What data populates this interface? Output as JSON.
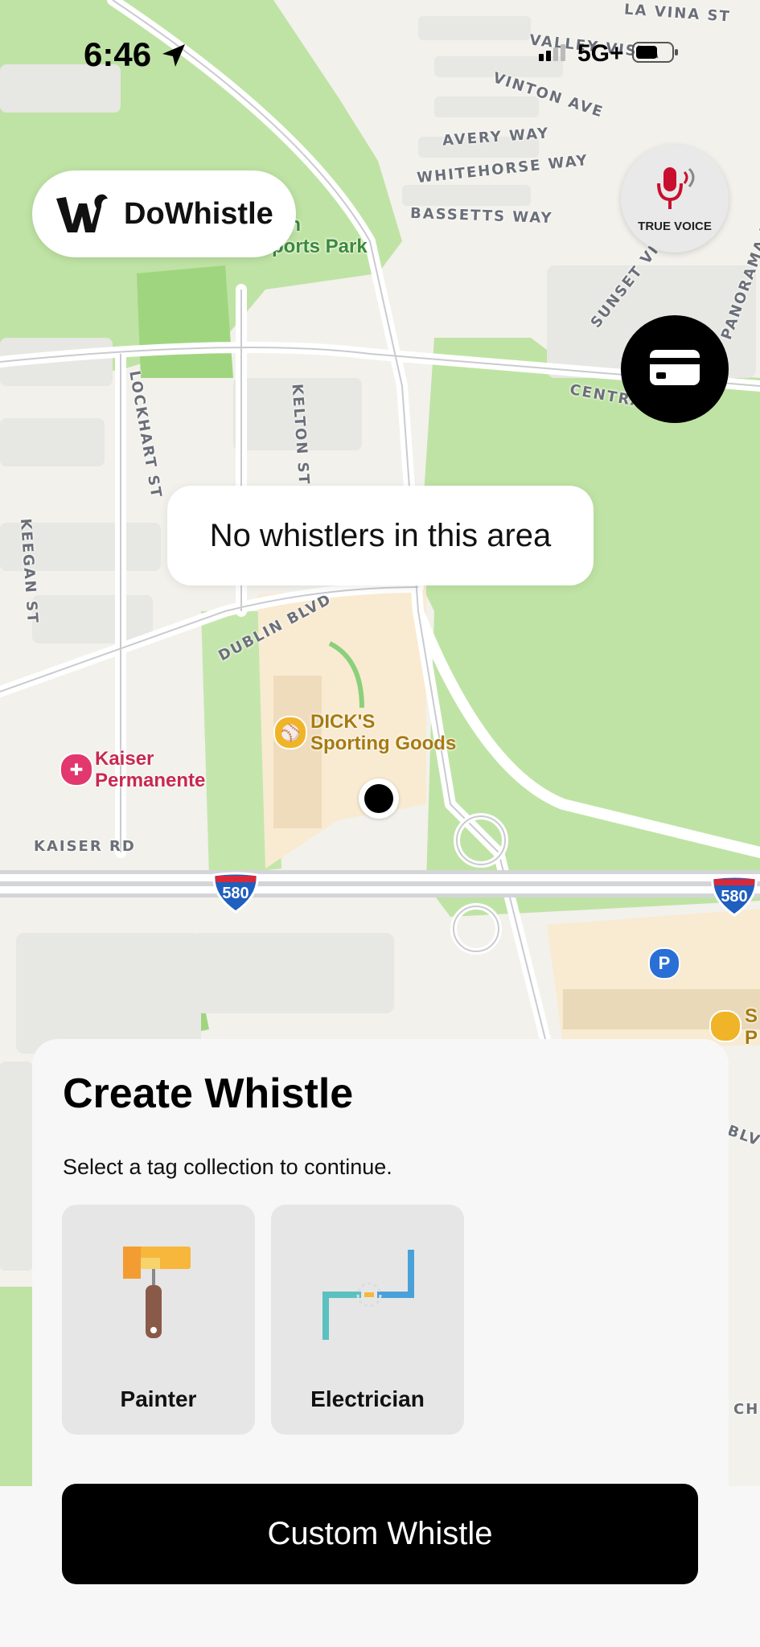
{
  "status_bar": {
    "time": "6:46",
    "network": "5G+"
  },
  "brand": {
    "name": "DoWhistle"
  },
  "true_voice": {
    "label": "TRUE VOICE"
  },
  "toast": {
    "message": "No whistlers in this area"
  },
  "map": {
    "streets": [
      "LA VINA ST",
      "VALLEY VISTA",
      "VINTON AVE",
      "AVERY WAY",
      "WHITEHORSE WAY",
      "BASSETTS WAY",
      "SUNSET VIE",
      "PANORAMA DR",
      "CENTRA",
      "LOCKHART ST",
      "KELTON ST",
      "KEEGAN ST",
      "DUBLIN BLVD",
      "KAISER RD",
      "BLV",
      "CH"
    ],
    "park": "lon\nports Park",
    "highway_shield": "580",
    "pois": {
      "dicks": "DICK'S\nSporting Goods",
      "kaiser": "Kaiser\nPermanente",
      "partial": "S\nP"
    },
    "parking": "P"
  },
  "sheet": {
    "title": "Create Whistle",
    "subtitle": "Select a tag collection to continue.",
    "cards": [
      {
        "label": "Painter",
        "icon": "paint-roller-icon"
      },
      {
        "label": "Electrician",
        "icon": "wire-spark-icon"
      }
    ],
    "custom_button": "Custom Whistle"
  }
}
